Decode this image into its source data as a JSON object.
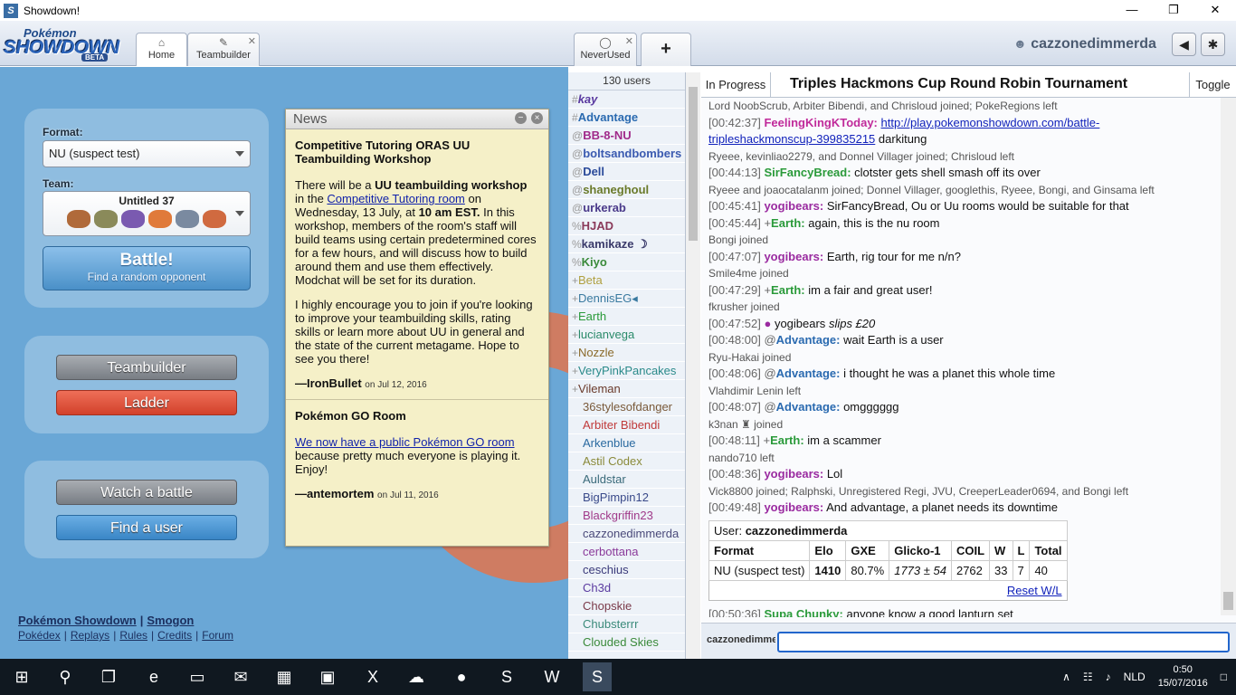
{
  "window": {
    "title": "Showdown!",
    "controls": [
      "—",
      "❐",
      "✕"
    ]
  },
  "header": {
    "logo": {
      "top": "Pokémon",
      "main": "SHOWDOWN",
      "badge": "BETA"
    },
    "tabs": [
      {
        "label": "Home",
        "icon": "⌂"
      },
      {
        "label": "Teambuilder",
        "icon": "✎",
        "close": "✕"
      },
      {
        "label": "NeverUsed",
        "icon": "◯",
        "close": "✕"
      }
    ],
    "new_tab": "+",
    "username": "cazzonedimmerda",
    "sound_icon": "◀",
    "settings_icon": "✱"
  },
  "home": {
    "format_label": "Format:",
    "format_value": "NU (suspect test)",
    "team_label": "Team:",
    "team_name": "Untitled 37",
    "team_colors": [
      "#b06a3a",
      "#8a8a5a",
      "#7a5ab0",
      "#e07a3a",
      "#7a8aa0",
      "#d06a40"
    ],
    "battle_title": "Battle!",
    "battle_sub": "Find a random opponent",
    "teambuilder": "Teambuilder",
    "ladder": "Ladder",
    "watch": "Watch a battle",
    "find_user": "Find a user",
    "footer_row1": [
      "Pokémon Showdown",
      "Smogon"
    ],
    "footer_row2": [
      "Pokédex",
      "Replays",
      "Rules",
      "Credits",
      "Forum"
    ],
    "sep": "|"
  },
  "news": {
    "title": "News",
    "items": [
      {
        "heading": "Competitive Tutoring ORAS UU Teambuilding Workshop",
        "p1a": "There will be a ",
        "p1b": "UU teambuilding workshop",
        "p1c": " in the ",
        "p1link": "Competitive Tutoring room",
        "p1d": " on Wednesday, 13 July, at ",
        "p1e": "10 am EST.",
        "p1f": " In this workshop, members of the room's staff will build teams using certain predetermined cores for a few hours, and will discuss how to build around them and use them effectively. Modchat will be set for its duration.",
        "p2": "I highly encourage you to join if you're looking to improve your teambuilding skills, rating skills or learn more about UU in general and the state of the current metagame. Hope to see you there!",
        "author": "—IronBullet",
        "date": "on Jul 12, 2016"
      },
      {
        "heading": "Pokémon GO Room",
        "link": "We now have a public Pokémon GO room",
        "p1": " because pretty much everyone is playing it. Enjoy!",
        "author": "—antemortem",
        "date": "on Jul 11, 2016"
      }
    ]
  },
  "userlist": {
    "count": "130 users",
    "users": [
      {
        "rank": "#",
        "name": "kay",
        "color": "#5a3aa0",
        "style": "bold-italic"
      },
      {
        "rank": "#",
        "name": "Advantage",
        "color": "#2a6ab0",
        "style": "bold"
      },
      {
        "rank": "@",
        "name": "BB-8-NU",
        "color": "#a02a8a",
        "style": "bold"
      },
      {
        "rank": "@",
        "name": "boltsandbombers",
        "color": "#3a5ab0",
        "style": "bold"
      },
      {
        "rank": "@",
        "name": "Dell",
        "color": "#2a4a9a",
        "style": "bold"
      },
      {
        "rank": "@",
        "name": "shaneghoul",
        "color": "#6a7a2a",
        "style": "bold"
      },
      {
        "rank": "@",
        "name": "urkerab",
        "color": "#4a3a8a",
        "style": "bold"
      },
      {
        "rank": "%",
        "name": "HJAD",
        "color": "#8a3a5a",
        "style": "bold"
      },
      {
        "rank": "%",
        "name": "kamikaze ☽",
        "color": "#3a3a6a",
        "style": "bold"
      },
      {
        "rank": "%",
        "name": "Kiyo",
        "color": "#3a8a3a",
        "style": "bold"
      },
      {
        "rank": "+",
        "name": "Beta",
        "color": "#b0a040",
        "style": "normal"
      },
      {
        "rank": "+",
        "name": "DennisEG◂",
        "color": "#3a7aa0",
        "style": "normal"
      },
      {
        "rank": "+",
        "name": "Earth",
        "color": "#2a9a3a",
        "style": "normal"
      },
      {
        "rank": "+",
        "name": "lucianvega",
        "color": "#2a8a6a",
        "style": "normal"
      },
      {
        "rank": "+",
        "name": "Nozzle",
        "color": "#8a6a2a",
        "style": "normal"
      },
      {
        "rank": "+",
        "name": "VeryPinkPancakes",
        "color": "#2a8a8a",
        "style": "normal"
      },
      {
        "rank": "+",
        "name": "Vileman",
        "color": "#6a3a2a",
        "style": "normal"
      },
      {
        "rank": "",
        "name": "36stylesofdanger",
        "color": "#7a5a3a",
        "style": "normal"
      },
      {
        "rank": "",
        "name": "Arbiter Bibendi",
        "color": "#c03a3a",
        "style": "normal"
      },
      {
        "rank": "",
        "name": "Arkenblue",
        "color": "#2a6aa0",
        "style": "normal"
      },
      {
        "rank": "",
        "name": "Astil Codex",
        "color": "#8a8a3a",
        "style": "normal"
      },
      {
        "rank": "",
        "name": "Auldstar",
        "color": "#3a6a7a",
        "style": "normal"
      },
      {
        "rank": "",
        "name": "BigPimpin12",
        "color": "#3a4a8a",
        "style": "normal"
      },
      {
        "rank": "",
        "name": "Blackgriffin23",
        "color": "#a03a8a",
        "style": "normal"
      },
      {
        "rank": "",
        "name": "cazzonedimmerda",
        "color": "#4a4a7a",
        "style": "normal"
      },
      {
        "rank": "",
        "name": "cerbottana",
        "color": "#8a3a9a",
        "style": "normal"
      },
      {
        "rank": "",
        "name": "ceschius",
        "color": "#3a3a7a",
        "style": "normal"
      },
      {
        "rank": "",
        "name": "Ch3d",
        "color": "#5a3aa0",
        "style": "normal"
      },
      {
        "rank": "",
        "name": "Chopskie",
        "color": "#7a3a4a",
        "style": "normal"
      },
      {
        "rank": "",
        "name": "Chubsterrr",
        "color": "#3a8a7a",
        "style": "normal"
      },
      {
        "rank": "",
        "name": "Clouded Skies",
        "color": "#3a8a3a",
        "style": "normal"
      }
    ]
  },
  "chat": {
    "status": "In Progress",
    "title": "Triples Hackmons Cup Round Robin Tournament",
    "toggle": "Toggle",
    "log": [
      {
        "type": "sys",
        "text": "Lord NoobScrub, Arbiter Bibendi, and Chrisloud joined; PokeRegions left"
      },
      {
        "type": "msg",
        "time": "[00:42:37]",
        "name": "FeelingKingKToday:",
        "color": "#c02a9a",
        "link": "http://play.pokemonshowdown.com/battle-",
        "link2": "tripleshackmonscup-399835215",
        "text": " darkitung"
      },
      {
        "type": "sys",
        "text": "Ryeee, kevinliao2279, and Donnel Villager joined; Chrisloud left"
      },
      {
        "type": "msg",
        "time": "[00:44:13]",
        "name": "SirFancyBread:",
        "color": "#2a9a3a",
        "text": "clotster gets shell smash off its over"
      },
      {
        "type": "sys",
        "text": "Ryeee and joaocatalanm joined; Donnel Villager, googlethis, Ryeee, Bongi, and Ginsama left"
      },
      {
        "type": "msg",
        "time": "[00:45:41]",
        "name": "yogibears:",
        "color": "#9a2aa0",
        "text": "SirFancyBread, Ou or Uu rooms would be suitable for that"
      },
      {
        "type": "msg",
        "time": "[00:45:44]",
        "prefix": "+",
        "name": "Earth:",
        "color": "#2a9a3a",
        "text": "again, this is the nu room"
      },
      {
        "type": "sys",
        "text": "Bongi joined"
      },
      {
        "type": "msg",
        "time": "[00:47:07]",
        "name": "yogibears:",
        "color": "#9a2aa0",
        "text": "Earth, rig tour for me n/n?"
      },
      {
        "type": "sys",
        "text": "Smile4me joined"
      },
      {
        "type": "msg",
        "time": "[00:47:29]",
        "prefix": "+",
        "name": "Earth:",
        "color": "#2a9a3a",
        "text": "im a fair and great user!"
      },
      {
        "type": "sys",
        "text": "fkrusher joined"
      },
      {
        "type": "emote",
        "time": "[00:47:52]",
        "name": "yogibears",
        "text": "slips £20"
      },
      {
        "type": "msg",
        "time": "[00:48:00]",
        "prefix": "@",
        "name": "Advantage:",
        "color": "#2a6ab0",
        "text": "wait Earth is a user"
      },
      {
        "type": "sys",
        "text": "Ryu-Hakai joined"
      },
      {
        "type": "msg",
        "time": "[00:48:06]",
        "prefix": "@",
        "name": "Advantage:",
        "color": "#2a6ab0",
        "text": "i thought he was a planet this whole time"
      },
      {
        "type": "sys",
        "text": "Vlahdimir Lenin left"
      },
      {
        "type": "msg",
        "time": "[00:48:07]",
        "prefix": "@",
        "name": "Advantage:",
        "color": "#2a6ab0",
        "text": "omgggggg"
      },
      {
        "type": "sys",
        "text": "k3nan ♜ joined"
      },
      {
        "type": "msg",
        "time": "[00:48:11]",
        "prefix": "+",
        "name": "Earth:",
        "color": "#2a9a3a",
        "text": "im a scammer"
      },
      {
        "type": "sys",
        "text": "nando710 left"
      },
      {
        "type": "msg",
        "time": "[00:48:36]",
        "name": "yogibears:",
        "color": "#9a2aa0",
        "text": "Lol"
      },
      {
        "type": "sys",
        "text": "Vick8800 joined; Ralphski, Unregistered Regi, JVU, CreeperLeader0694, and Bongi left"
      },
      {
        "type": "msg",
        "time": "[00:49:48]",
        "name": "yogibears:",
        "color": "#9a2aa0",
        "text": "And advantage, a planet needs its downtime"
      }
    ],
    "rank_user_label": "User:",
    "rank_user": "cazzonedimmerda",
    "rank_headers": [
      "Format",
      "Elo",
      "GXE",
      "Glicko-1",
      "COIL",
      "W",
      "L",
      "Total"
    ],
    "rank_row": [
      "NU (suspect test)",
      "1410",
      "80.7%",
      "1773 ± 54",
      "2762",
      "33",
      "7",
      "40"
    ],
    "reset": "Reset W/L",
    "last": {
      "time": "[00:50:36]",
      "name": "Supa Chunky:",
      "color": "#2a9a3a",
      "text": "anyone know a good lanturn set"
    },
    "input_name": "cazzonedimmerda"
  },
  "taskbar": {
    "icons": [
      "⊞",
      "⚲",
      "❐",
      "e",
      "▭",
      "✉",
      "▦",
      "▣",
      "X",
      "☁",
      "●",
      "S",
      "W",
      "S"
    ],
    "tray": {
      "up": "∧",
      "lang": "NLD",
      "time": "0:50",
      "date": "15/07/2016"
    }
  }
}
